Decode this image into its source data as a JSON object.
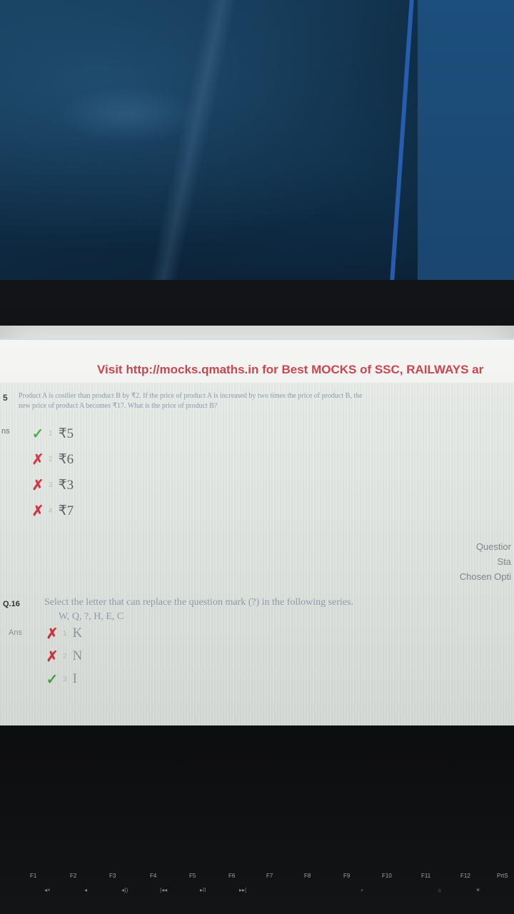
{
  "screen": {
    "banner": "Visit http://mocks.qmaths.in for Best MOCKS of SSC, RAILWAYS ar"
  },
  "question1": {
    "number": "5",
    "text_line1": "Product A is costlier than product B by ₹2. If the price of product A is increased by two times the price of product B, the",
    "text_line2": "new price of product A becomes ₹17. What is the price of product B?",
    "ans_label": "ns",
    "options": [
      {
        "num": "1",
        "value": "₹5",
        "status": "correct"
      },
      {
        "num": "2",
        "value": "₹6",
        "status": "wrong"
      },
      {
        "num": "3",
        "value": "₹3",
        "status": "wrong"
      },
      {
        "num": "4",
        "value": "₹7",
        "status": "wrong"
      }
    ],
    "side_info": [
      "Questior",
      "Sta",
      "Chosen Opti"
    ]
  },
  "question2": {
    "number": "Q.16",
    "text": "Select the letter that can replace the question mark (?) in the following series.",
    "series": "W, Q, ?, H, E, C",
    "ans_label": "Ans",
    "options": [
      {
        "num": "1",
        "value": "K",
        "status": "wrong"
      },
      {
        "num": "2",
        "value": "N",
        "status": "wrong"
      },
      {
        "num": "3",
        "value": "I",
        "status": "correct"
      }
    ]
  },
  "function_keys": [
    "F1",
    "F2",
    "F3",
    "F4",
    "F5",
    "F6",
    "F7",
    "F8",
    "F9",
    "F10",
    "F11",
    "F12",
    "PrtS"
  ],
  "colors": {
    "banner_red": "#c0202c",
    "correct": "#3aa33a",
    "wrong": "#d4232f"
  }
}
